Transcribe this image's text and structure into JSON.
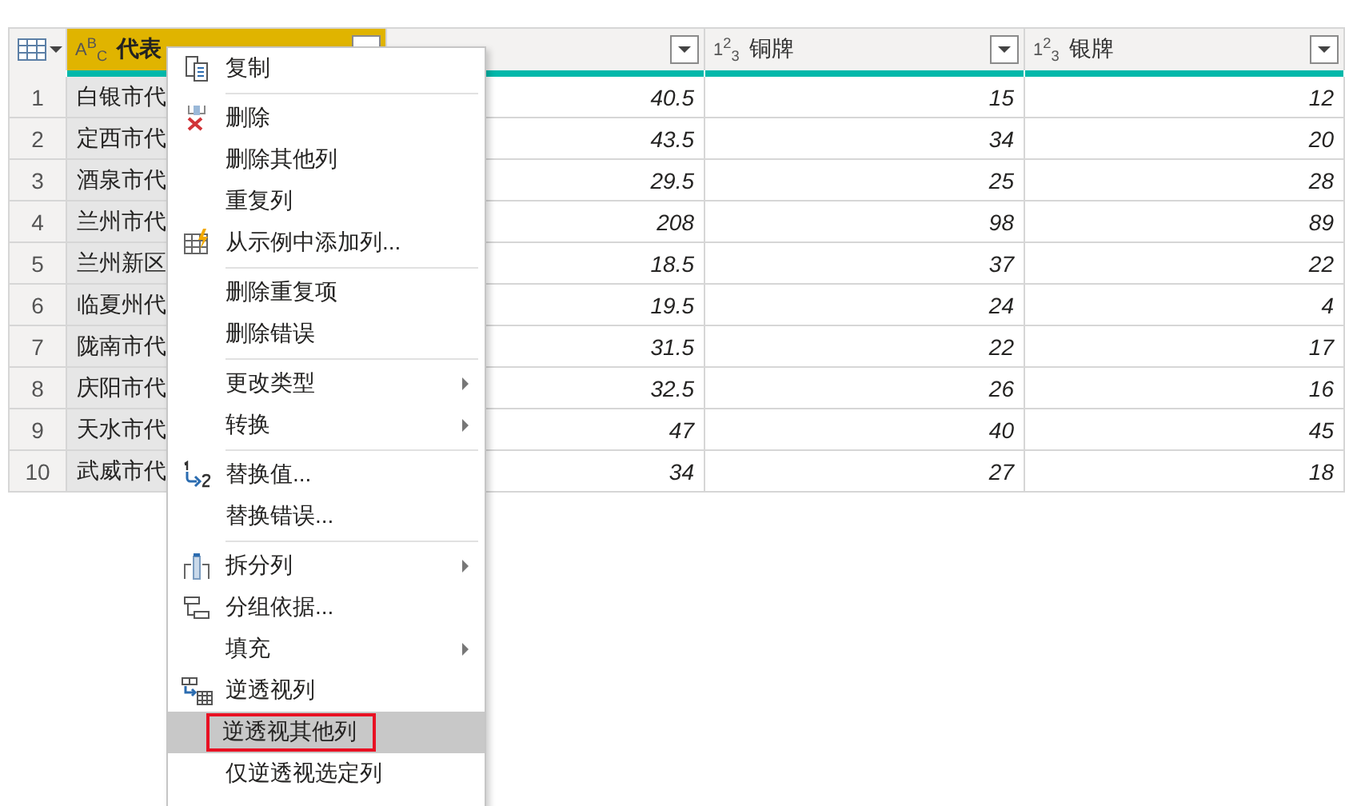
{
  "table": {
    "columns": [
      {
        "type_label": "A$^{B}$$_{C}$",
        "name": "代表",
        "selected": true
      },
      {
        "selected": false
      },
      {
        "type_label": "1$^{2}$$_{3}$",
        "name": "铜牌",
        "selected": false
      },
      {
        "type_label": "1$^{2}$$_{3}$",
        "name": "银牌",
        "selected": false
      }
    ],
    "rows": [
      {
        "number": "1",
        "cells": [
          "白银市代",
          "40.5",
          "15",
          "12"
        ]
      },
      {
        "number": "2",
        "cells": [
          "定西市代",
          "43.5",
          "34",
          "20"
        ]
      },
      {
        "number": "3",
        "cells": [
          "酒泉市代",
          "29.5",
          "25",
          "28"
        ]
      },
      {
        "number": "4",
        "cells": [
          "兰州市代",
          "208",
          "98",
          "89"
        ]
      },
      {
        "number": "5",
        "cells": [
          "兰州新区",
          "18.5",
          "37",
          "22"
        ]
      },
      {
        "number": "6",
        "cells": [
          "临夏州代",
          "19.5",
          "24",
          "4"
        ]
      },
      {
        "number": "7",
        "cells": [
          "陇南市代",
          "31.5",
          "22",
          "17"
        ]
      },
      {
        "number": "8",
        "cells": [
          "庆阳市代",
          "32.5",
          "26",
          "16"
        ]
      },
      {
        "number": "9",
        "cells": [
          "天水市代",
          "47",
          "40",
          "45"
        ]
      },
      {
        "number": "10",
        "cells": [
          "武威市代",
          "34",
          "27",
          "18"
        ]
      }
    ]
  },
  "context_menu": {
    "items": [
      {
        "kind": "item",
        "label": "复制",
        "submenu": false,
        "selected": false
      },
      {
        "kind": "separator"
      },
      {
        "kind": "item",
        "label": "删除",
        "submenu": false,
        "selected": false
      },
      {
        "kind": "item",
        "label": "删除其他列",
        "submenu": false,
        "selected": false
      },
      {
        "kind": "item",
        "label": "重复列",
        "submenu": false,
        "selected": false
      },
      {
        "kind": "item",
        "label": "从示例中添加列...",
        "submenu": false,
        "selected": false
      },
      {
        "kind": "separator"
      },
      {
        "kind": "item",
        "label": "删除重复项",
        "submenu": false,
        "selected": false
      },
      {
        "kind": "item",
        "label": "删除错误",
        "submenu": false,
        "selected": false
      },
      {
        "kind": "separator"
      },
      {
        "kind": "item",
        "label": "更改类型",
        "submenu": true,
        "selected": false
      },
      {
        "kind": "item",
        "label": "转换",
        "submenu": true,
        "selected": false
      },
      {
        "kind": "separator"
      },
      {
        "kind": "item",
        "label": "替换值...",
        "submenu": false,
        "selected": false
      },
      {
        "kind": "item",
        "label": "替换错误...",
        "submenu": false,
        "selected": false
      },
      {
        "kind": "separator"
      },
      {
        "kind": "item",
        "label": "拆分列",
        "submenu": true,
        "selected": false
      },
      {
        "kind": "item",
        "label": "分组依据...",
        "submenu": false,
        "selected": false
      },
      {
        "kind": "item",
        "label": "填充",
        "submenu": true,
        "selected": false
      },
      {
        "kind": "item",
        "label": "逆透视列",
        "submenu": false,
        "selected": false
      },
      {
        "kind": "item",
        "label": "逆透视其他列",
        "submenu": false,
        "selected": true
      },
      {
        "kind": "item",
        "label": "仅逆透视选定列",
        "submenu": false,
        "selected": false
      }
    ]
  }
}
